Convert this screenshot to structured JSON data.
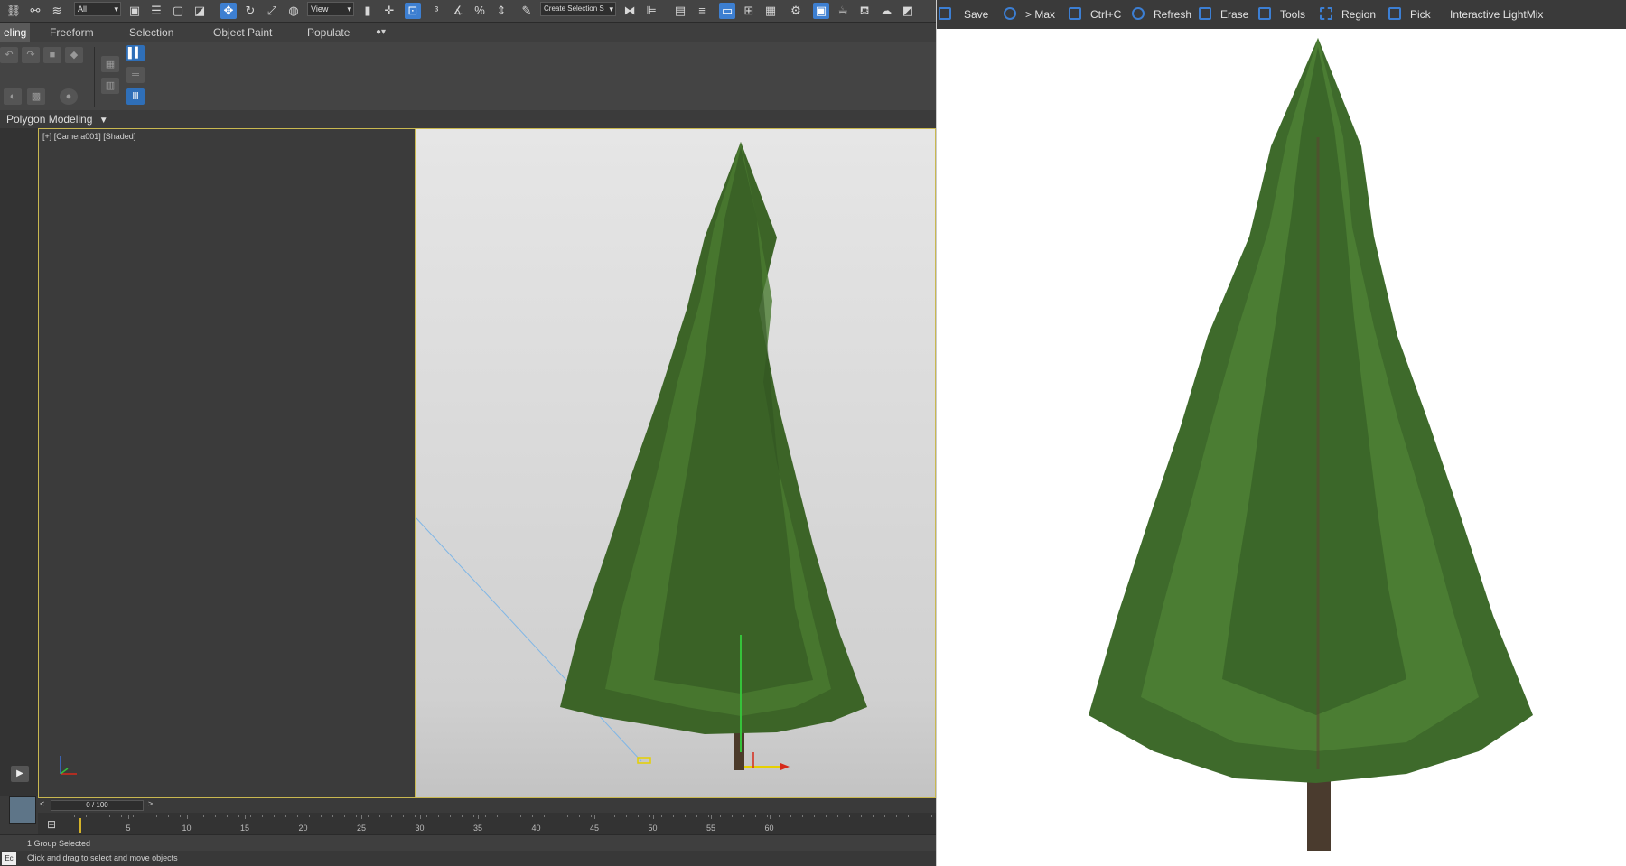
{
  "max": {
    "toolbar": {
      "filter_dropdown": "All",
      "refcoord_dropdown": "View",
      "selection_set": "Create Selection S"
    },
    "ribbon_tabs": [
      {
        "label": "eling",
        "active": true
      },
      {
        "label": "Freeform",
        "active": false
      },
      {
        "label": "Selection",
        "active": false
      },
      {
        "label": "Object Paint",
        "active": false
      },
      {
        "label": "Populate",
        "active": false
      }
    ],
    "panel_label": "Polygon Modeling",
    "viewport_label": "[+] [Camera001] [Shaded]",
    "time_slider": "0 / 100",
    "track_ticks": [
      "5",
      "10",
      "15",
      "20",
      "25",
      "30",
      "35",
      "40",
      "45",
      "50",
      "55",
      "60"
    ],
    "status_line": "1 Group Selected",
    "prompt_line": "Click and drag to select and move objects",
    "status_box": "Ec"
  },
  "vfb": {
    "toolbar": [
      {
        "icon": "save-icon",
        "label": "Save"
      },
      {
        "icon": "to-max-icon",
        "label": "> Max"
      },
      {
        "icon": "copy-icon",
        "label": "Ctrl+C"
      },
      {
        "icon": "refresh-icon",
        "label": "Refresh"
      },
      {
        "icon": "erase-icon",
        "label": "Erase"
      },
      {
        "icon": "tools-icon",
        "label": "Tools"
      },
      {
        "icon": "region-icon",
        "label": "Region"
      },
      {
        "icon": "pick-icon",
        "label": "Pick"
      },
      {
        "icon": "",
        "label": "Interactive LightMix"
      }
    ]
  },
  "colors": {
    "accent": "#3c7fd4",
    "viewport_border": "#c9b850",
    "foliage": "#3f6a2a"
  }
}
